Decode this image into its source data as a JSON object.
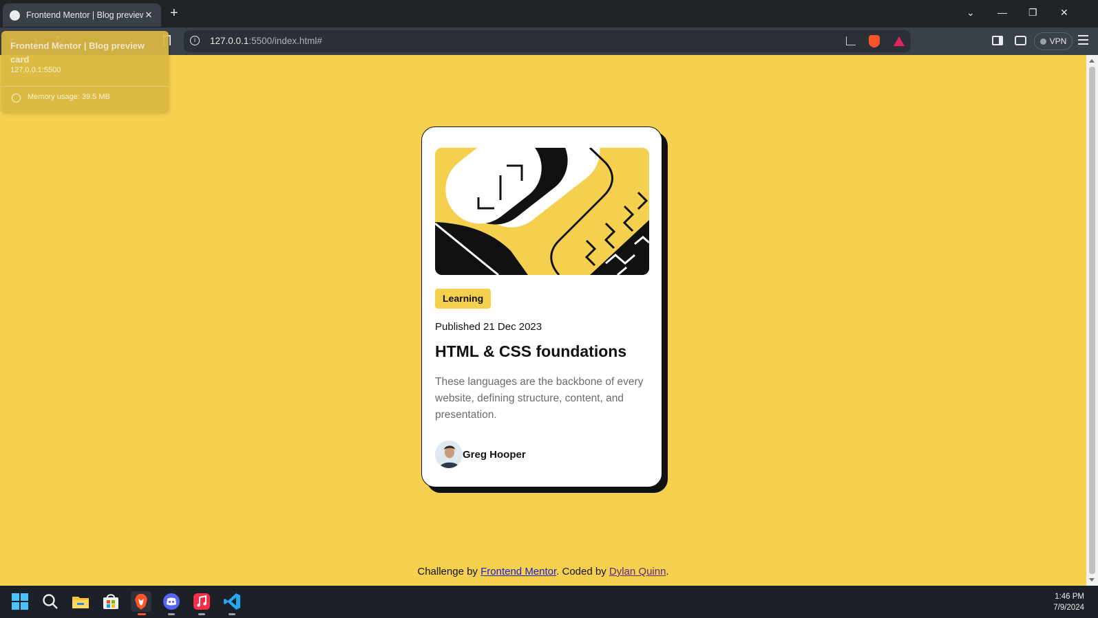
{
  "browser": {
    "tab_title": "Frontend Mentor | Blog preview",
    "tab_close": "✕",
    "new_tab": "+",
    "window_controls": [
      "⌄",
      "—",
      "❐",
      "✕"
    ],
    "nav": {
      "back": "‹",
      "forward": "›",
      "reload": "↻"
    },
    "url_host": "127.0.0.1",
    "url_rest": ":5500/index.html#",
    "vpn_label": "VPN",
    "hover_card": {
      "title": "Frontend Mentor | Blog preview card",
      "url": "127.0.0.1:5500",
      "memory": "Memory usage: 39.5 MB"
    },
    "icons": [
      "info-icon",
      "bookmark-icon",
      "share-icon",
      "brave-shields-icon",
      "brave-rewards-icon",
      "sidebar-icon",
      "wallet-icon",
      "menu-icon"
    ]
  },
  "card": {
    "tag": "Learning",
    "published": "Published 21 Dec 2023",
    "title": "HTML & CSS foundations",
    "description": "These languages are the backbone of every website, defining structure, content, and presentation.",
    "author": "Greg Hooper"
  },
  "attribution": {
    "prefix": "Challenge by ",
    "link1": "Frontend Mentor",
    "middle": ". Coded by ",
    "link2": "Dylan Quinn",
    "suffix": "."
  },
  "taskbar": {
    "apps": [
      "windows-start-icon",
      "search-icon",
      "file-explorer-icon",
      "microsoft-store-icon",
      "brave-browser-icon",
      "discord-icon",
      "apple-music-icon",
      "vscode-icon"
    ],
    "time": "1:46 PM",
    "date": "7/9/2024"
  },
  "colors": {
    "page_background": "#f4d04e",
    "card_background": "#ffffff",
    "shadow": "#111111",
    "text_muted": "#6b6b6b",
    "link": "#2020c8"
  }
}
